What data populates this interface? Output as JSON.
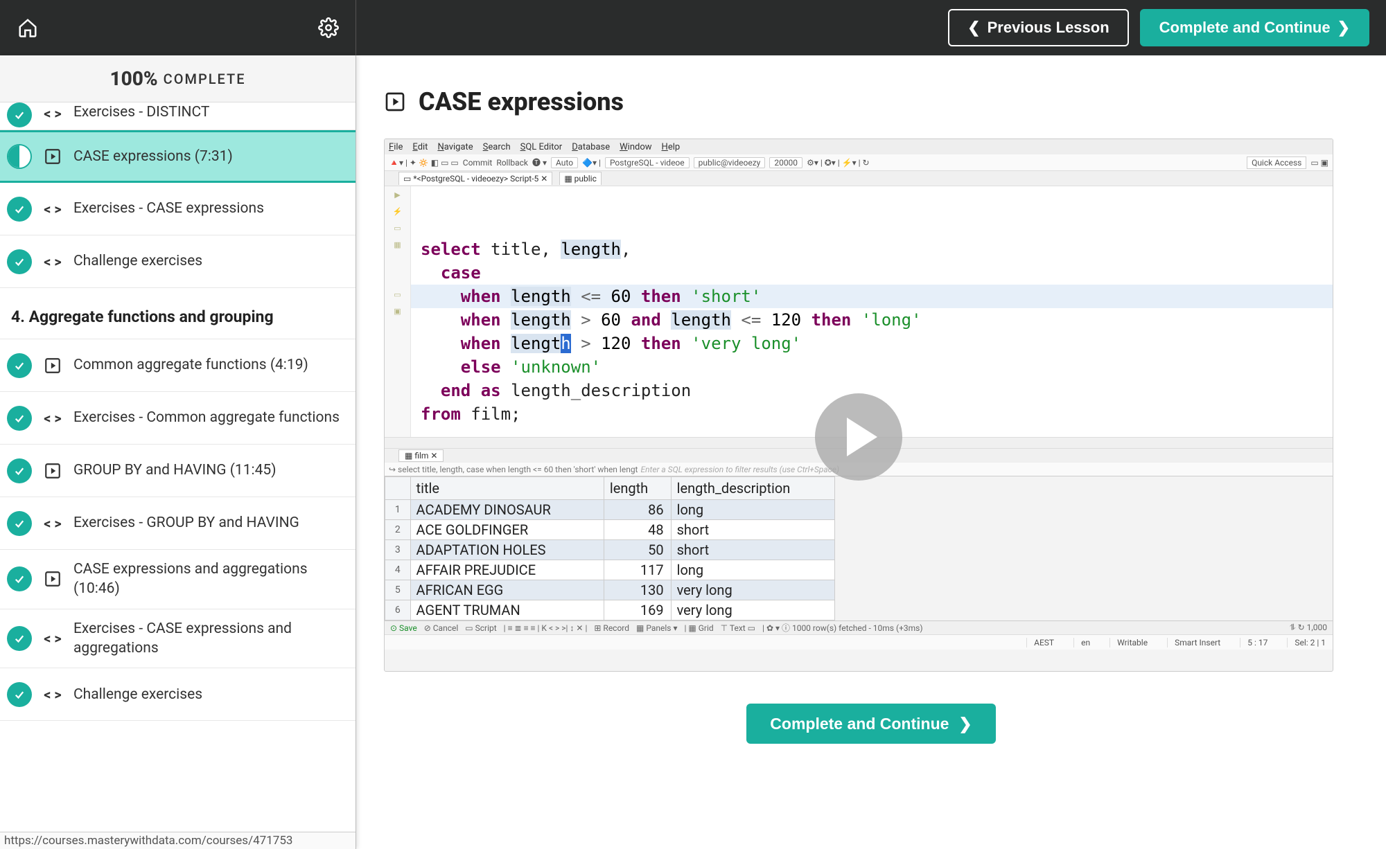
{
  "topbar": {
    "previous_label": "Previous Lesson",
    "continue_label": "Complete and Continue"
  },
  "progress": {
    "percent": "100%",
    "label": "COMPLETE"
  },
  "sidebar_items": [
    {
      "status": "done",
      "type": "code",
      "title": "Exercises - DISTINCT",
      "partial": true
    },
    {
      "status": "half",
      "type": "video",
      "title": "CASE expressions (7:31)",
      "active": true
    },
    {
      "status": "done",
      "type": "code",
      "title": "Exercises - CASE expressions"
    },
    {
      "status": "done",
      "type": "code",
      "title": "Challenge exercises"
    }
  ],
  "section_title": "4. Aggregate functions and grouping",
  "sidebar_items2": [
    {
      "status": "done",
      "type": "video",
      "title": "Common aggregate functions (4:19)"
    },
    {
      "status": "done",
      "type": "code",
      "title": "Exercises - Common aggregate functions"
    },
    {
      "status": "done",
      "type": "video",
      "title": "GROUP BY and HAVING (11:45)"
    },
    {
      "status": "done",
      "type": "code",
      "title": "Exercises - GROUP BY and HAVING"
    },
    {
      "status": "done",
      "type": "video",
      "title": "CASE expressions and aggregations (10:46)"
    },
    {
      "status": "done",
      "type": "code",
      "title": "Exercises - CASE expressions and aggregations"
    },
    {
      "status": "done",
      "type": "code",
      "title": "Challenge exercises"
    }
  ],
  "status_url": "https://courses.masterywithdata.com/courses/471753",
  "main": {
    "title": "CASE expressions",
    "continue_button": "Complete and Continue"
  },
  "ide": {
    "menus": [
      "File",
      "Edit",
      "Navigate",
      "Search",
      "SQL Editor",
      "Database",
      "Window",
      "Help"
    ],
    "toolbar": {
      "commit": "Commit",
      "rollback": "Rollback",
      "auto": "Auto",
      "conn": "PostgreSQL - videoe",
      "db": "public@videoezy",
      "rows": "20000",
      "quick_access": "Quick Access"
    },
    "tabs": {
      "script": "*<PostgreSQL - videoezy> Script-5",
      "schema": "public"
    },
    "code_tokens": {
      "l1a": "select ",
      "l1b": "title, ",
      "l1c": "length",
      "l1d": ",",
      "l2": "case",
      "l3a": "when ",
      "l3b": "length",
      "l3c": " <= ",
      "l3d": "60",
      "l3e": " then",
      "l3f": " 'short'",
      "l4a": "when ",
      "l4b": "length",
      "l4c": " > ",
      "l4d": "60",
      "l4e": " and ",
      "l4f": "length",
      "l4g": " <= ",
      "l4h": "120",
      "l4i": " then",
      "l4j": " 'long'",
      "l5a": "when ",
      "l5b": "lengt",
      "l5b2": "h",
      "l5c": " > ",
      "l5d": "120",
      "l5e": " then",
      "l5f": " 'very long'",
      "l6a": "else ",
      "l6b": "'unknown'",
      "l7a": "end as ",
      "l7b": "length_description",
      "l8a": "from ",
      "l8b": "film",
      ";": ";"
    },
    "result_tab": "film",
    "filter_prefix": "select title, length, case when length <= 60 then 'short' when lengt",
    "filter_hint": "Enter a SQL expression to filter results (use Ctrl+Space)",
    "grid_headers": [
      "title",
      "length",
      "length_description"
    ],
    "grid_rows": [
      {
        "n": "1",
        "title": "ACADEMY DINOSAUR",
        "length": "86",
        "desc": "long"
      },
      {
        "n": "2",
        "title": "ACE GOLDFINGER",
        "length": "48",
        "desc": "short"
      },
      {
        "n": "3",
        "title": "ADAPTATION HOLES",
        "length": "50",
        "desc": "short"
      },
      {
        "n": "4",
        "title": "AFFAIR PREJUDICE",
        "length": "117",
        "desc": "long"
      },
      {
        "n": "5",
        "title": "AFRICAN EGG",
        "length": "130",
        "desc": "very long"
      },
      {
        "n": "6",
        "title": "AGENT TRUMAN",
        "length": "169",
        "desc": "very long"
      }
    ],
    "bottom": {
      "save": "Save",
      "cancel": "Cancel",
      "script": "Script",
      "record": "Record",
      "panels": "Panels",
      "grid": "Grid",
      "text": "Text",
      "fetch_status": "1000 row(s) fetched - 10ms (+3ms)",
      "rowcount": "1,000"
    },
    "status": {
      "tz": "AEST",
      "lang": "en",
      "mode": "Writable",
      "ins": "Smart Insert",
      "pos": "5 : 17",
      "sel": "Sel: 2 | 1"
    }
  }
}
